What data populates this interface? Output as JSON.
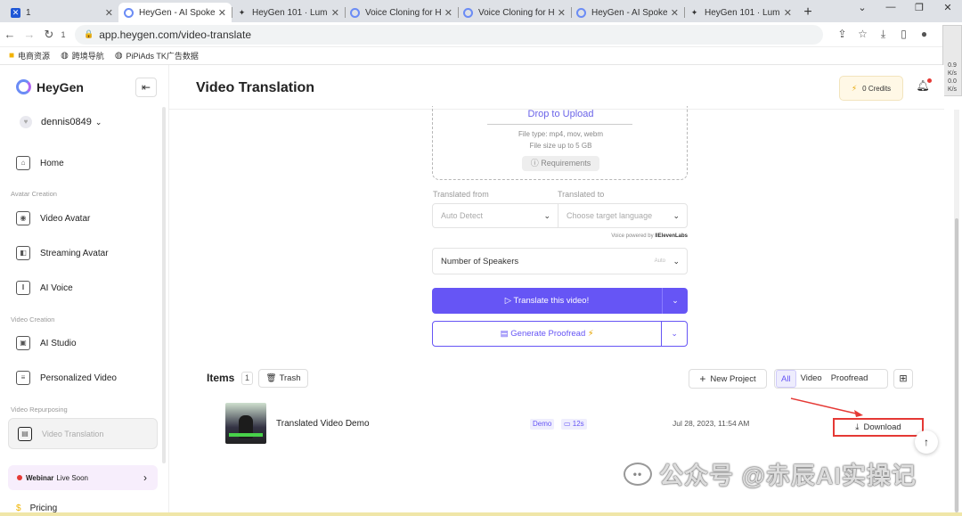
{
  "browser": {
    "tabs": [
      {
        "title": "1",
        "icon": "x-logo-icon",
        "active": false
      },
      {
        "title": "HeyGen - AI Spoke",
        "icon": "heygen-logo-icon",
        "active": true
      },
      {
        "title": "HeyGen 101 · Luma",
        "icon": "luma-icon",
        "active": false
      },
      {
        "title": "Voice Cloning for H",
        "icon": "heygen-logo-icon",
        "active": false
      },
      {
        "title": "Voice Cloning for H",
        "icon": "heygen-logo-icon",
        "active": false
      },
      {
        "title": "HeyGen - AI Spoke",
        "icon": "heygen-logo-icon",
        "active": false
      },
      {
        "title": "HeyGen 101 · Luma",
        "icon": "luma-icon",
        "active": false
      }
    ],
    "url": "app.heygen.com/video-translate",
    "reload_badge": "1",
    "bookmarks": [
      "电商资源",
      "跨境导航",
      "PiPiAds TK广告数据"
    ],
    "side_widget": [
      "0.9",
      "K/s",
      "0.0",
      "K/s"
    ]
  },
  "sidebar": {
    "brand": "HeyGen",
    "username": "dennis0849",
    "sections": {
      "avatar_creation": "Avatar Creation",
      "video_creation": "Video Creation",
      "video_repurposing": "Video Repurposing"
    },
    "items": {
      "home": "Home",
      "video_avatar": "Video Avatar",
      "streaming_avatar": "Streaming Avatar",
      "ai_voice": "AI Voice",
      "ai_studio": "AI Studio",
      "personalized_video": "Personalized Video",
      "video_translation": "Video Translation"
    },
    "webinar": {
      "bold": "Webinar",
      "text": "Live Soon"
    },
    "pricing": "Pricing"
  },
  "header": {
    "title": "Video Translation",
    "credits": "0 Credits"
  },
  "upload": {
    "link": "Drop to Upload",
    "file_type": "File type: mp4, mov, webm",
    "file_size": "File size up to 5 GB",
    "requirements": "Requirements"
  },
  "form": {
    "from_label": "Translated from",
    "to_label": "Translated to",
    "from_value": "Auto Detect",
    "to_placeholder": "Choose target language",
    "powered_prefix": "Voice powered by",
    "powered_brand": "IIElevenLabs",
    "speakers_label": "Number of Speakers",
    "speakers_value": "Auto",
    "translate_btn": "Translate this video!",
    "proofread_btn": "Generate Proofread"
  },
  "items": {
    "title": "Items",
    "count": "1",
    "trash": "Trash",
    "new_project": "New Project",
    "filters": [
      "All",
      "Video",
      "Proofread"
    ],
    "active_filter": "All",
    "rows": [
      {
        "title": "Translated Video Demo",
        "tag": "Demo",
        "duration": "12s",
        "date": "Jul 28, 2023, 11:54 AM",
        "action": "Download"
      }
    ]
  },
  "watermark": "公众号 @赤辰AI实操记",
  "colors": {
    "accent": "#6655f5",
    "highlight": "#e53935"
  }
}
